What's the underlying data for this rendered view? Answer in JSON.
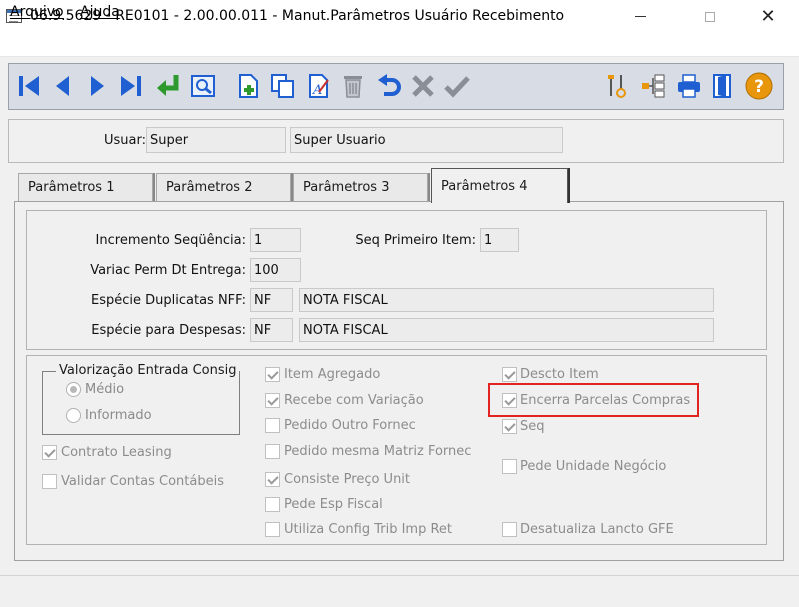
{
  "window": {
    "title": "06.9.5629 - RE0101 - 2.00.00.011 - Manut.Parâmetros Usuário Recebimento",
    "close_symbol": "✕"
  },
  "menu": {
    "arquivo": "Arquivo",
    "ajuda": "Ajuda"
  },
  "toolbar": {
    "buttons": [
      "first-icon",
      "previous-icon",
      "next-icon",
      "last-icon",
      "goto-icon",
      "search-icon",
      "new-icon",
      "copy-icon",
      "edit-icon",
      "delete-icon",
      "undo-icon",
      "cancel-icon",
      "confirm-icon",
      "tools-icon",
      "hierarchy-icon",
      "print-icon",
      "exit-icon",
      "help-icon"
    ],
    "help_symbol": "?",
    "colors": {
      "primary": "#1f5fd1",
      "green": "#2e9a2e",
      "gray": "#8a8e96",
      "orange": "#e8960c"
    }
  },
  "user": {
    "label": "Usuar:",
    "code": "Super",
    "name": "Super Usuario"
  },
  "tabs": [
    "Parâmetros 1",
    "Parâmetros 2",
    "Parâmetros 3",
    "Parâmetros 4"
  ],
  "form": {
    "incremento_label": "Incremento Seqüência:",
    "incremento_value": "1",
    "seq_primeiro_label": "Seq Primeiro Item:",
    "seq_primeiro_value": "1",
    "variac_label": "Variac Perm Dt Entrega:",
    "variac_value": "100",
    "especie_dup_label": "Espécie Duplicatas NFF:",
    "especie_dup_code": "NF",
    "especie_dup_desc": "NOTA FISCAL",
    "especie_desp_label": "Espécie para Despesas:",
    "especie_desp_code": "NF",
    "especie_desp_desc": "NOTA FISCAL"
  },
  "valorizacao": {
    "title": "Valorização Entrada Consig",
    "opt_medio": "Médio",
    "opt_informado": "Informado",
    "selected": "Médio"
  },
  "checkboxes": {
    "contrato_leasing": "Contrato Leasing",
    "validar_contas": "Validar Contas Contábeis",
    "item_agregado": "Item Agregado",
    "recebe_variacao": "Recebe com Variação",
    "pedido_outro": "Pedido Outro Fornec",
    "pedido_matriz": "Pedido mesma Matriz Fornec",
    "consiste_preco": "Consiste Preço Unit",
    "pede_esp_fiscal": "Pede Esp Fiscal",
    "utiliza_config": "Utiliza Config Trib Imp Ret",
    "descto_item": "Descto Item",
    "encerra_parcelas": "Encerra Parcelas Compras",
    "seq": "Seq",
    "pede_unidade": "Pede Unidade Negócio",
    "desatualiza_lancto": "Desatualiza Lancto GFE"
  },
  "highlight_color": "#e32222"
}
